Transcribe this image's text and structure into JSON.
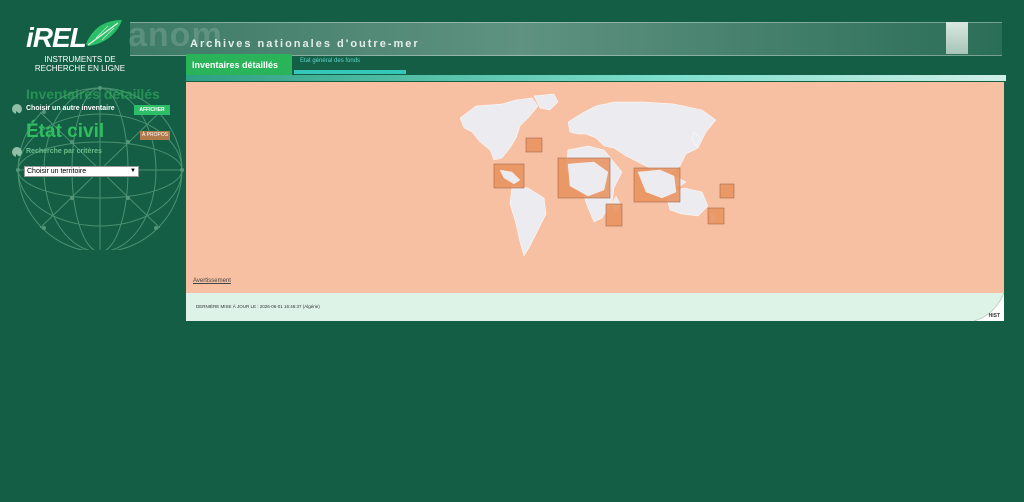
{
  "header": {
    "logo_text": "iREL",
    "logo_subtitle_line1": "INSTRUMENTS DE",
    "logo_subtitle_line2": "RECHERCHE EN LIGNE",
    "brand_watermark": "anom",
    "site_title": "Archives nationales d'outre-mer"
  },
  "tabs": [
    {
      "label": "Inventaires détaillés",
      "active": true
    },
    {
      "label": "Etat général des fonds",
      "active": false
    }
  ],
  "sidebar": {
    "section_title": "Inventaires détaillés",
    "choose_inventory_label": "Choisir un autre inventaire",
    "afficher_button": "AFFICHER",
    "inventory_name": "État civil",
    "apropos_button": "À PROPOS",
    "search_label": "Recherche par critères",
    "territory_select": {
      "value": "Choisir un territoire"
    }
  },
  "main": {
    "warning_link": "Avertissement",
    "background_color": "#f8c0a2",
    "highlight_color": "#e8905c"
  },
  "footer": {
    "last_update": "DERNIÈRE MISE À JOUR LE : 2026-06-01 15:46:37 (Algérie)",
    "history_link": "HIST"
  },
  "colors": {
    "page_bg": "#135e45",
    "tab_active": "#29b45a",
    "accent_green": "#2fbd60"
  }
}
